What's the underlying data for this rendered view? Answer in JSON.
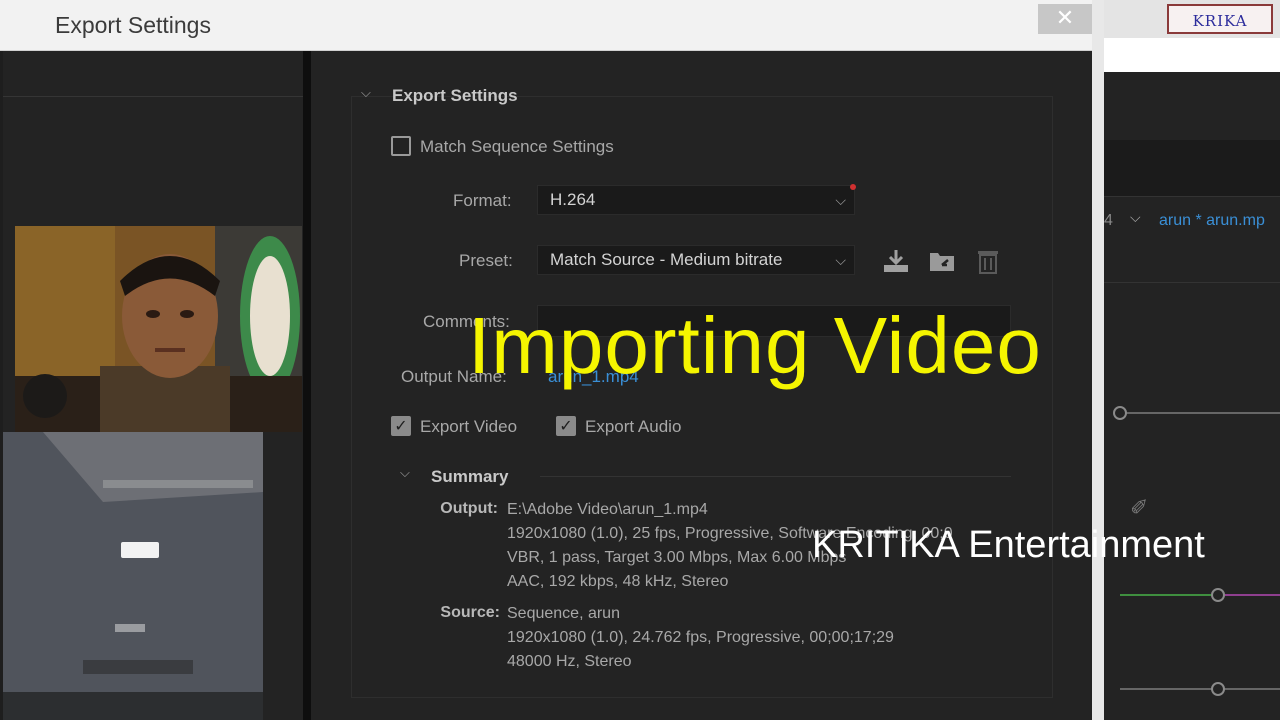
{
  "window": {
    "title": "Export Settings",
    "close_label": "✕"
  },
  "logo": {
    "text": "KRIKA"
  },
  "export_settings": {
    "header": "Export Settings",
    "match_sequence_label": "Match Sequence Settings",
    "match_sequence_checked": false,
    "format_label": "Format:",
    "format_value": "H.264",
    "preset_label": "Preset:",
    "preset_value": "Match Source - Medium bitrate",
    "comments_label": "Comments:",
    "comments_value": "",
    "output_name_label": "Output Name:",
    "output_name_value": "arun_1.mp4",
    "export_video_label": "Export Video",
    "export_video_checked": true,
    "export_audio_label": "Export Audio",
    "export_audio_checked": true
  },
  "summary": {
    "header": "Summary",
    "output_label": "Output:",
    "output_lines": [
      "E:\\Adobe Video\\arun_1.mp4",
      "1920x1080 (1.0), 25 fps, Progressive, Software Encoding, 00;0",
      "VBR, 1 pass, Target 3.00 Mbps, Max 6.00 Mbps",
      "AAC, 192 kbps, 48 kHz, Stereo"
    ],
    "source_label": "Source:",
    "source_lines": [
      "Sequence, arun",
      "1920x1080 (1.0), 24.762 fps, Progressive, 00;00;17;29",
      "48000 Hz, Stereo"
    ]
  },
  "right_panel": {
    "sequence_tab": "arun * arun.mp",
    "sequence_num": "4"
  },
  "overlay": {
    "main_text": "Importing Video",
    "sub_text": "KRITIKA Entertainment"
  },
  "colors": {
    "overlay_main": "#f5f500",
    "overlay_sub": "#ffffff",
    "link_blue": "#3a8fd6"
  }
}
